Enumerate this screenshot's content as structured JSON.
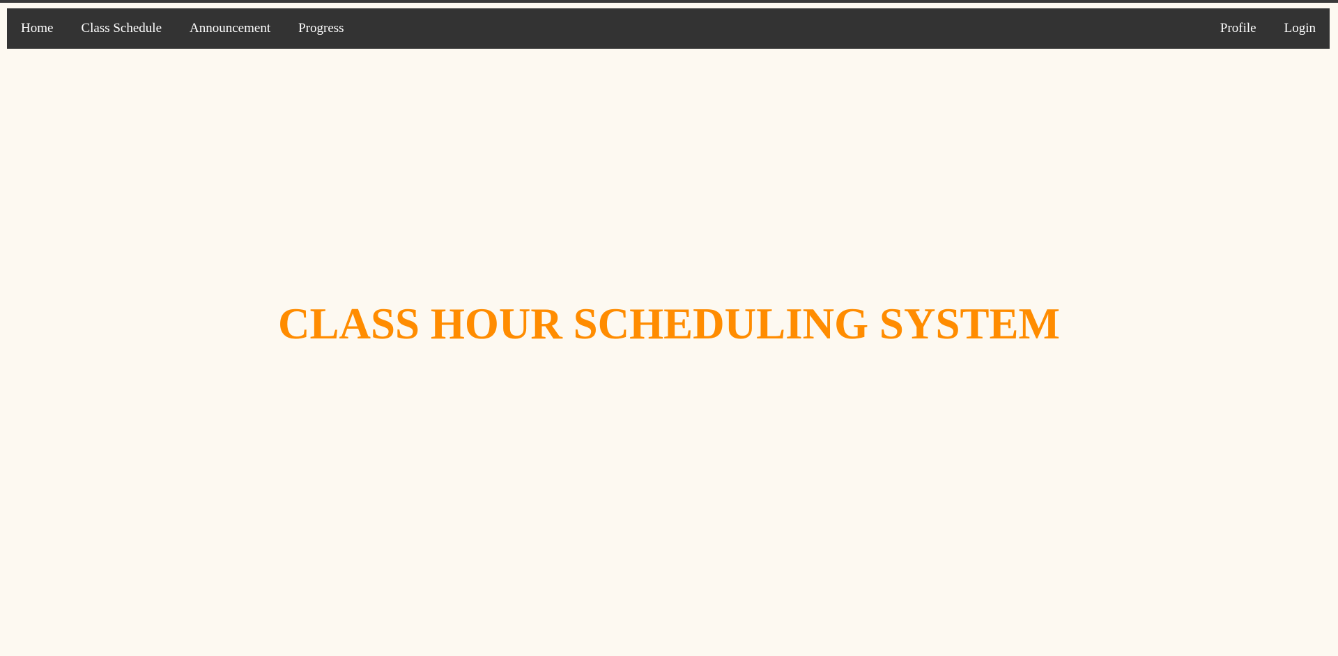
{
  "nav": {
    "left_items": [
      {
        "label": "Home"
      },
      {
        "label": "Class Schedule"
      },
      {
        "label": "Announcement"
      },
      {
        "label": "Progress"
      }
    ],
    "right_items": [
      {
        "label": "Profile"
      },
      {
        "label": "Login"
      }
    ]
  },
  "hero": {
    "title": "CLASS HOUR SCHEDULING SYSTEM"
  },
  "colors": {
    "page_background": "#fdf9f1",
    "navbar_background": "#333333",
    "nav_text": "#ffffff",
    "title_accent": "#ff8c00"
  }
}
